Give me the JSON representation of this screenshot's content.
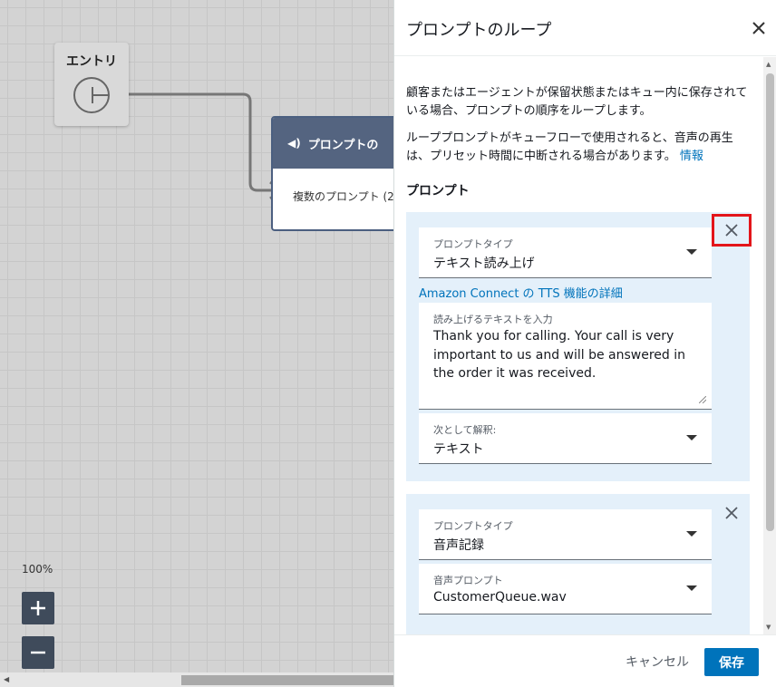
{
  "canvas": {
    "entry_node": {
      "label": "エントリ"
    },
    "prompt_node": {
      "title": "プロンプトの",
      "body": "複数のプロンプト (2"
    },
    "zoom": {
      "level": "100%",
      "zoom_in": "+",
      "zoom_out": "−"
    }
  },
  "panel": {
    "title": "プロンプトのループ",
    "description_1": "顧客またはエージェントが保留状態またはキュー内に保存されている場合、プロンプトの順序をループします。",
    "description_2": "ループプロンプトがキューフローで使用されると、音声の再生は、プリセット時間に中断される場合があります。",
    "info_link": "情報",
    "section_title": "プロンプト",
    "prompts": [
      {
        "type_label": "プロンプトタイプ",
        "type_value": "テキスト読み上げ",
        "tts_link": "Amazon Connect の TTS 機能の詳細",
        "text_label": "読み上げるテキストを入力",
        "text_value": "Thank you for calling. Your call is very important to us and will be answered in the order it was received.",
        "interpret_label": "次として解釈:",
        "interpret_value": "テキスト"
      },
      {
        "type_label": "プロンプトタイプ",
        "type_value": "音声記録",
        "audio_label": "音声プロンプト",
        "audio_value": "CustomerQueue.wav"
      }
    ],
    "footer": {
      "cancel": "キャンセル",
      "save": "保存"
    }
  },
  "colors": {
    "accent": "#0073bb",
    "highlight": "#e3151a",
    "card_bg": "#e4f0fa",
    "node_header": "#546480"
  }
}
